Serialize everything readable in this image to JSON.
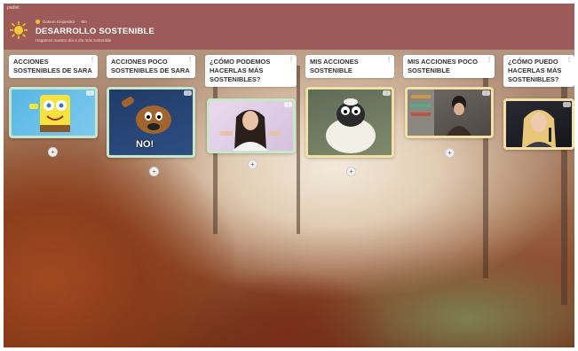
{
  "app": {
    "label": "padlet",
    "author": "Gotson Gispestira",
    "time": "8m",
    "title": "DESARROLLO SOSTENIBLE",
    "subtitle": "Hagamos nuestro día a día más sostenible"
  },
  "columns": [
    {
      "header": "ACCIONES SOSTENIBLES DE SARA",
      "menu": "⋮",
      "card_corner": "⋮",
      "card_image": "spongebob-gif",
      "add_label": "+"
    },
    {
      "header": "ACCIONES POCO SOSTENIBLES DE SARA",
      "menu": "⋮",
      "card_corner": "⋮",
      "card_image": "scooby-no-gif",
      "card_caption": "NO!",
      "add_label": "+"
    },
    {
      "header": "¿CÓMO PODEMOS HACERLAS MÁS SOSTENIBLES?",
      "menu": "⋮",
      "card_corner": "⋮",
      "card_image": "shrugging-woman-gif",
      "add_label": "+"
    },
    {
      "header": "MIS ACCIONES SOSTENIBLE",
      "menu": "⋮",
      "card_corner": "⋮",
      "card_image": "shaun-the-sheep-gif",
      "add_label": "+"
    },
    {
      "header": "MIS ACCIONES POCO SOSTENIBLE",
      "menu": "⋮",
      "card_corner": "⋮",
      "card_image": "store-scene-gif",
      "add_label": "+"
    },
    {
      "header": "¿CÓMO PUEDO HACERLAS MÁS SOSTENIBLES?",
      "menu": "⋮",
      "card_corner": "⋮",
      "card_image": "britney-gif",
      "add_label": "+"
    }
  ],
  "colors": {
    "topbar": "#9c5a58",
    "card_green_border": "#c9e7c8",
    "card_yellow_border": "#f4e0a6"
  }
}
